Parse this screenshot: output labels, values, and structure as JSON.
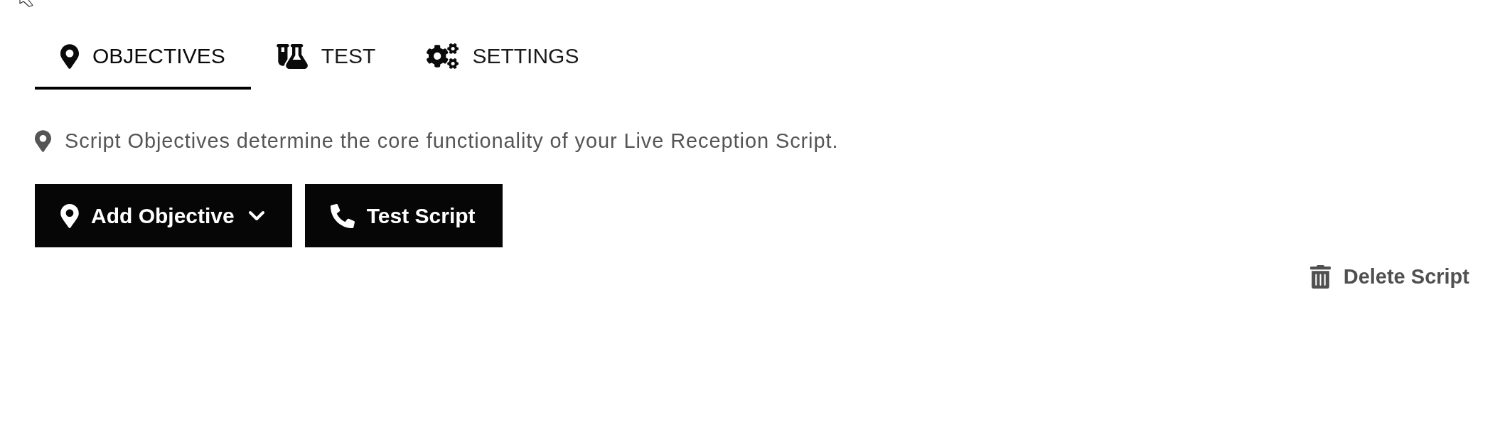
{
  "tabs": [
    {
      "label": "OBJECTIVES",
      "selected": true
    },
    {
      "label": "TEST",
      "selected": false
    },
    {
      "label": "SETTINGS",
      "selected": false
    }
  ],
  "description": "Script Objectives determine the core functionality of your Live Reception Script.",
  "buttons": [
    {
      "kind": "dropdown",
      "label": "Add Objective"
    },
    {
      "kind": "action",
      "label": "Test Script"
    }
  ],
  "delete_link": {
    "label": "Delete Script"
  }
}
